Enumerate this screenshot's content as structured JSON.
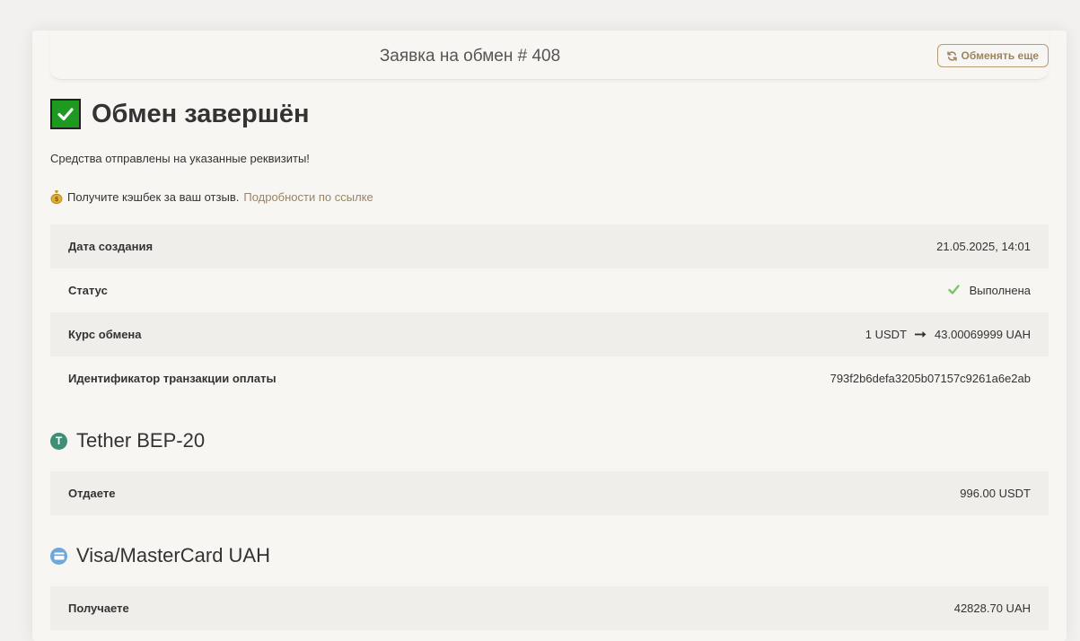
{
  "header": {
    "title": "Заявка на обмен # 408",
    "exchange_more_label": "Обменять еще"
  },
  "status": {
    "title": "Обмен завершён",
    "message": "Средства отправлены на указанные реквизиты!",
    "cashback_text": "Получите кэшбек за ваш отзыв.",
    "cashback_link": "Подробности по ссылке"
  },
  "details": [
    {
      "label": "Дата создания",
      "value": "21.05.2025, 14:01"
    },
    {
      "label": "Статус",
      "value": "Выполнена"
    },
    {
      "label": "Курс обмена",
      "from": "1 USDT",
      "to": "43.00069999 UAH"
    },
    {
      "label": "Идентификатор транзакции оплаты",
      "value": "793f2b6defa3205b07157c9261a6e2ab"
    }
  ],
  "give": {
    "title": "Tether BEP-20",
    "label": "Отдаете",
    "value": "996.00 USDT"
  },
  "receive": {
    "title": "Visa/MasterCard UAH",
    "label": "Получаете",
    "value": "42828.70 UAH"
  },
  "colors": {
    "accent": "#9a8463",
    "success": "#1c9b20",
    "check_green": "#7cc46a"
  },
  "icons": {
    "refresh": "refresh-icon",
    "status": "check-mark-icon",
    "cashback": "money-bag-icon",
    "arrow": "arrow-right-icon",
    "tether": "tether-icon",
    "card": "credit-card-icon"
  }
}
